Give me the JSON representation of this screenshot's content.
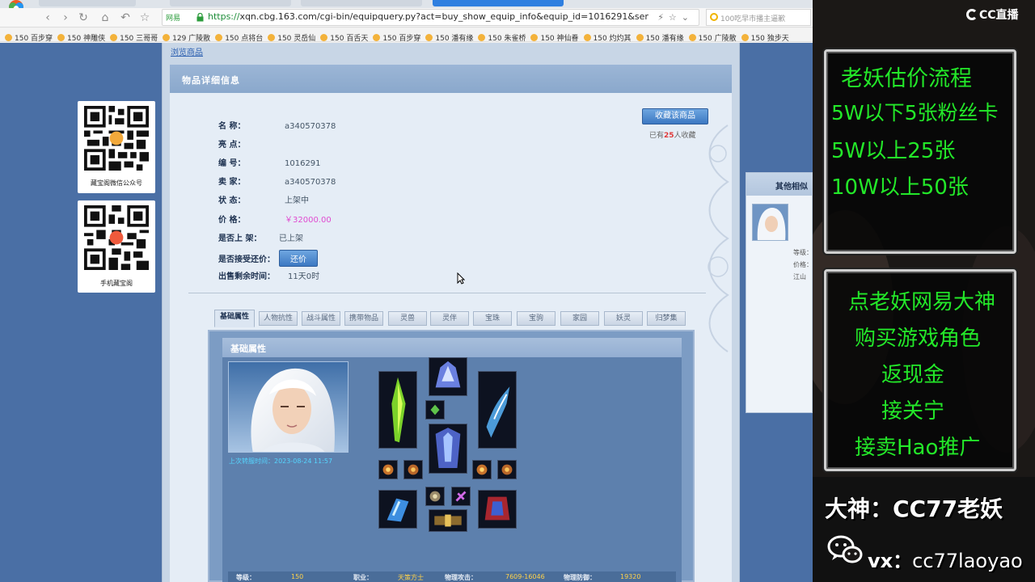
{
  "browser": {
    "address": {
      "site_badge": "网易",
      "url_scheme": "https://",
      "url_rest": "xqn.cbg.163.com/cgi-bin/equipquery.py?act=buy_show_equip_info&equip_id=1016291&server_ic"
    },
    "search": {
      "text": "100吃早市播主逼歉"
    },
    "bookmarks": [
      "150 百步穿",
      "150 神雕侠",
      "150 三哥哥",
      "129 广陵散",
      "150 点将台",
      "150 灵岳仙",
      "150 百舌天",
      "150 百步穿",
      "150 潘有缘",
      "150 朱雀桥",
      "150 神仙眷",
      "150 灼灼其",
      "150 潘有缘",
      "150 广陵散",
      "150 独步天"
    ]
  },
  "page": {
    "breadcrumb": "浏览商品",
    "detail_title": "物品详细信息",
    "fields": {
      "name_label": "名          称：",
      "name_value": "a340570378",
      "highlight_label": "亮          点：",
      "highlight_value": "",
      "id_label": "编          号：",
      "id_value": "1016291",
      "seller_label": "卖          家：",
      "seller_value": "a340570378",
      "status_label": "状          态：",
      "status_value": "上架中",
      "price_label": "价          格：",
      "price_value": "￥32000.00",
      "listed_label": "是否上 架：",
      "listed_value": "已上架",
      "counter_label": "是否接受还价：",
      "counter_button": "还价",
      "remaining_label": "出售剩余时间：",
      "remaining_value": "11天0时"
    },
    "favorite": {
      "button": "收藏该商品",
      "prefix": "已有",
      "count": "25",
      "suffix": "人收藏"
    },
    "tabs": [
      "基础属性",
      "人物抗性",
      "战斗属性",
      "携带物品",
      "灵兽",
      "灵伴",
      "宝珠",
      "宝驹",
      "家园",
      "妖灵",
      "归梦集"
    ],
    "attr_box": {
      "title": "基础属性",
      "transfer_time": "上次转服时间：2023-08-24 11:57",
      "stats": [
        {
          "label": "等级：",
          "value": "150"
        },
        {
          "label": "职业：",
          "value": "天策方士"
        },
        {
          "label": "物理攻击：",
          "value": "7609-16046"
        },
        {
          "label": "物理防御：",
          "value": "19320"
        }
      ]
    },
    "qr": [
      {
        "caption": "藏宝阁微信公众号"
      },
      {
        "caption": "手机藏宝阁"
      }
    ],
    "similar": {
      "title": "其他相似",
      "lines": [
        "等级：",
        "价格：",
        "江山"
      ]
    }
  },
  "stream": {
    "logo": "CC直播",
    "sign1": [
      "老妖估价流程",
      "5W以下5张粉丝卡",
      "5W以上25张",
      "10W以上50张"
    ],
    "sign2": [
      "点老妖网易大神",
      "购买游戏角色",
      "返现金",
      "接关宁",
      "接卖Hao推广"
    ],
    "dashen": "大神：CC77老妖",
    "vx_prefix": "vx：",
    "vx_id": "cc77laoyao"
  },
  "colors": {
    "accent": "#2f7fe0",
    "sign_text": "#23e829",
    "price": "#e04bd0",
    "stat_value": "#ffd24a"
  },
  "icons": [
    "browser-logo-icon",
    "lock-icon",
    "search-icon",
    "bookmark-icon",
    "wechat-icon",
    "cc-logo-icon",
    "cursor-icon"
  ]
}
